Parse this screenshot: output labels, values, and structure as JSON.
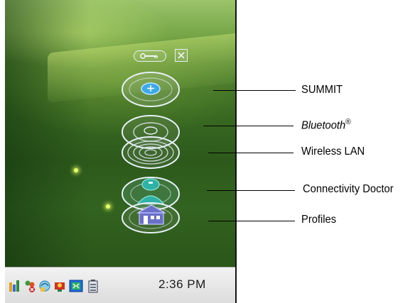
{
  "taskbar": {
    "clock": "2:36 PM",
    "icons": [
      "network-icon",
      "users-icon",
      "sync-icon",
      "connectivity-icon",
      "screen-icon",
      "battery-icon"
    ]
  },
  "toolbar": {
    "settings_icon": "wrench-icon",
    "close_icon": "close-icon"
  },
  "stack_layers": [
    "summit",
    "bluetooth",
    "wireless-lan",
    "connectivity-doctor",
    "profiles"
  ],
  "callouts": {
    "summit": "SUMMIT",
    "bluetooth": "Bluetooth",
    "bluetooth_mark": "®",
    "wireless_lan": "Wireless LAN",
    "connectivity_doctor": "Connectivity Doctor",
    "profiles": "Profiles"
  },
  "colors": {
    "disc_ring": "#e6f0f7",
    "summit_button": "#3da9e6",
    "doctor_teal": "#2fb1a6",
    "profiles_purple": "#6a6fc8",
    "taskbar": "#e6e6e6"
  }
}
